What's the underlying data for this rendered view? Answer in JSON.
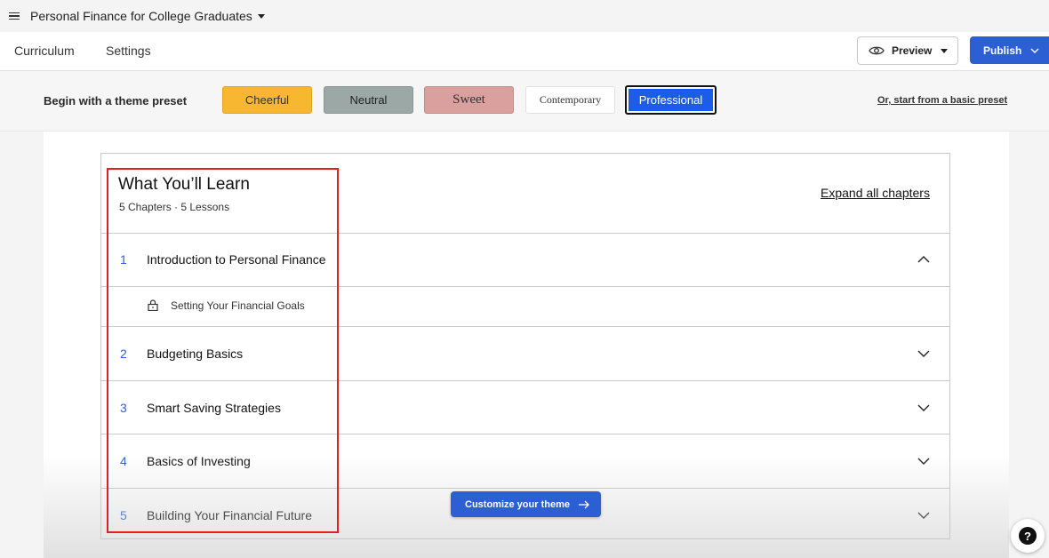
{
  "topbar": {
    "course_title": "Personal Finance for College Graduates"
  },
  "tabs": {
    "curriculum": "Curriculum",
    "settings": "Settings"
  },
  "toolbar": {
    "preview_label": "Preview",
    "publish_label": "Publish"
  },
  "presets": {
    "label": "Begin with a theme preset",
    "items": [
      "Cheerful",
      "Neutral",
      "Sweet",
      "Contemporary",
      "Professional"
    ],
    "selected": "Professional",
    "basic_link": "Or, start from a basic preset"
  },
  "curriculum": {
    "title": "What You’ll Learn",
    "subtitle": "5 Chapters · 5 Lessons",
    "expand_all": "Expand all chapters",
    "chapters": [
      {
        "num": "1",
        "title": "Introduction to Personal Finance",
        "expanded": true
      },
      {
        "num": "2",
        "title": "Budgeting Basics",
        "expanded": false
      },
      {
        "num": "3",
        "title": "Smart Saving Strategies",
        "expanded": false
      },
      {
        "num": "4",
        "title": "Basics of Investing",
        "expanded": false
      },
      {
        "num": "5",
        "title": "Building Your Financial Future",
        "expanded": false
      }
    ],
    "lesson": {
      "title": "Setting Your Financial Goals",
      "icon": "lock-icon"
    }
  },
  "customize_label": "Customize your theme",
  "help_label": "?",
  "colors": {
    "accent": "#2c5fd3",
    "highlight": "#e02020"
  }
}
